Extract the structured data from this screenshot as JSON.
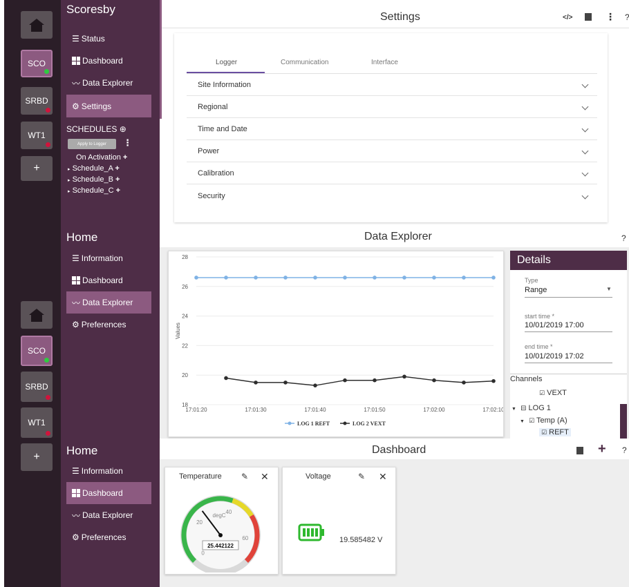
{
  "colors": {
    "rail": "#2b1e28",
    "nav": "#4e2d47",
    "active": "#8c5a80",
    "accent": "#6a4ea0",
    "green": "#2ecc40",
    "red": "#d0143c"
  },
  "rail_top": [
    {
      "label": "SCO",
      "status": "green"
    },
    {
      "label": "SRBD",
      "status": "red"
    },
    {
      "label": "WT1",
      "status": "red"
    }
  ],
  "rail_bottom": [
    {
      "label": "SCO",
      "status": "green"
    },
    {
      "label": "SRBD",
      "status": "red"
    },
    {
      "label": "WT1",
      "status": "red"
    }
  ],
  "rail_plus": "+",
  "nav1": {
    "title": "Scoresby",
    "items": [
      "Status",
      "Dashboard",
      "Data Explorer",
      "Settings"
    ],
    "schedules_label": "SCHEDULES",
    "apply_button": "Apply to Logger",
    "on_activation": "On Activation",
    "schedules": [
      "Schedule_A",
      "Schedule_B",
      "Schedule_C"
    ]
  },
  "nav2": {
    "title": "Home",
    "items": [
      "Information",
      "Dashboard",
      "Data Explorer",
      "Preferences"
    ]
  },
  "nav3": {
    "title": "Home",
    "items": [
      "Information",
      "Dashboard",
      "Data Explorer",
      "Preferences"
    ]
  },
  "settings": {
    "title": "Settings",
    "tabs": [
      "Logger",
      "Communication",
      "Interface"
    ],
    "sections": [
      "Site Information",
      "Regional",
      "Time and Date",
      "Power",
      "Calibration",
      "Security"
    ]
  },
  "explorer": {
    "title": "Data Explorer",
    "help": "?",
    "details": {
      "title": "Details",
      "type_label": "Type",
      "type_value": "Range",
      "start_label": "start time *",
      "start_value": "10/01/2019 17:00",
      "end_label": "end time *",
      "end_value": "10/01/2019 17:02",
      "channels_label": "Channels",
      "tree": [
        "VEXT",
        "LOG 1",
        "Temp (A)",
        "REFT"
      ]
    }
  },
  "chart_data": {
    "type": "line",
    "x": [
      "17:01:20",
      "17:01:25",
      "17:01:30",
      "17:01:35",
      "17:01:40",
      "17:01:45",
      "17:01:50",
      "17:01:55",
      "17:02:00",
      "17:02:05",
      "17:02:10"
    ],
    "xticks": [
      "17:01:20",
      "17:01:30",
      "17:01:40",
      "17:01:50",
      "17:02:00",
      "17:02:10"
    ],
    "ylabel": "Values",
    "ylim": [
      18,
      28
    ],
    "yticks": [
      "18",
      "20",
      "22",
      "24",
      "26",
      "28"
    ],
    "series": [
      {
        "name": "LOG 1 REFT",
        "color": "#7fb2e5",
        "values": [
          26.6,
          26.6,
          26.6,
          26.6,
          26.6,
          26.6,
          26.6,
          26.6,
          26.6,
          26.6,
          26.6
        ]
      },
      {
        "name": "LOG 2 VEXT",
        "color": "#2d2d2d",
        "values": [
          null,
          19.8,
          19.5,
          19.5,
          19.3,
          19.65,
          19.65,
          19.9,
          19.65,
          19.5,
          19.6
        ]
      }
    ],
    "legend_position": "bottom"
  },
  "dashboard": {
    "title": "Dashboard",
    "help": "?",
    "temperature": {
      "title": "Temperature",
      "unit": "degC",
      "value": "25.442122",
      "ticks": [
        "0",
        "20",
        "40",
        "60"
      ],
      "level": 25.44,
      "max": 70
    },
    "voltage": {
      "title": "Voltage",
      "value": "19.585482 V"
    }
  }
}
